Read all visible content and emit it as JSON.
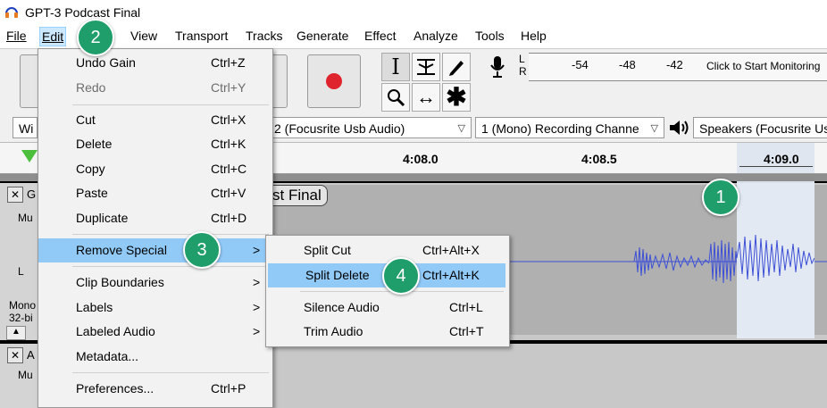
{
  "window": {
    "title": "GPT-3 Podcast Final"
  },
  "menubar": {
    "items": [
      {
        "label": "File"
      },
      {
        "label": "Edit"
      },
      {
        "label": "t"
      },
      {
        "label": "View"
      },
      {
        "label": "Transport"
      },
      {
        "label": "Tracks"
      },
      {
        "label": "Generate"
      },
      {
        "label": "Effect"
      },
      {
        "label": "Analyze"
      },
      {
        "label": "Tools"
      },
      {
        "label": "Help"
      }
    ]
  },
  "meter": {
    "l": "L",
    "r": "R",
    "ticks": [
      "-54",
      "-48",
      "-42"
    ],
    "monitor_text": "Click to Start Monitoring"
  },
  "devices": {
    "host_partial": "Wi",
    "input": "2 (Focusrite Usb Audio)",
    "channels": "1 (Mono) Recording Channe",
    "output": "Speakers (Focusrite Usb"
  },
  "timeline": {
    "ticks": [
      "4:08.0",
      "4:08.5",
      "4:09.0"
    ]
  },
  "track1": {
    "name_partial": "G",
    "clip_title_partial": "st Final",
    "mute_partial": "Mu",
    "l": "L",
    "info_mono": "Mono",
    "info_bits": "32-bi"
  },
  "track2": {
    "name_partial": "A",
    "mute_partial": "Mu"
  },
  "edit_menu": {
    "items": [
      {
        "label": "Undo Gain",
        "shortcut": "Ctrl+Z"
      },
      {
        "label": "Redo",
        "shortcut": "Ctrl+Y"
      },
      {
        "label": "Cut",
        "shortcut": "Ctrl+X"
      },
      {
        "label": "Delete",
        "shortcut": "Ctrl+K"
      },
      {
        "label": "Copy",
        "shortcut": "Ctrl+C"
      },
      {
        "label": "Paste",
        "shortcut": "Ctrl+V"
      },
      {
        "label": "Duplicate",
        "shortcut": "Ctrl+D"
      },
      {
        "label": "Remove Special",
        "shortcut": ">"
      },
      {
        "label": "Clip Boundaries",
        "shortcut": ">"
      },
      {
        "label": "Labels",
        "shortcut": ">"
      },
      {
        "label": "Labeled Audio",
        "shortcut": ">"
      },
      {
        "label": "Metadata..."
      },
      {
        "label": "Preferences...",
        "shortcut": "Ctrl+P"
      }
    ]
  },
  "submenu": {
    "items": [
      {
        "label": "Split Cut",
        "shortcut": "Ctrl+Alt+X"
      },
      {
        "label": "Split Delete",
        "shortcut": "Ctrl+Alt+K"
      },
      {
        "label": "Silence Audio",
        "shortcut": "Ctrl+L"
      },
      {
        "label": "Trim Audio",
        "shortcut": "Ctrl+T"
      }
    ]
  },
  "badges": [
    "1",
    "2",
    "3",
    "4"
  ],
  "colors": {
    "badge": "#1f9d6b",
    "highlight": "#91c9f7",
    "waveform": "#3c4fd6",
    "record": "#e0242d"
  }
}
